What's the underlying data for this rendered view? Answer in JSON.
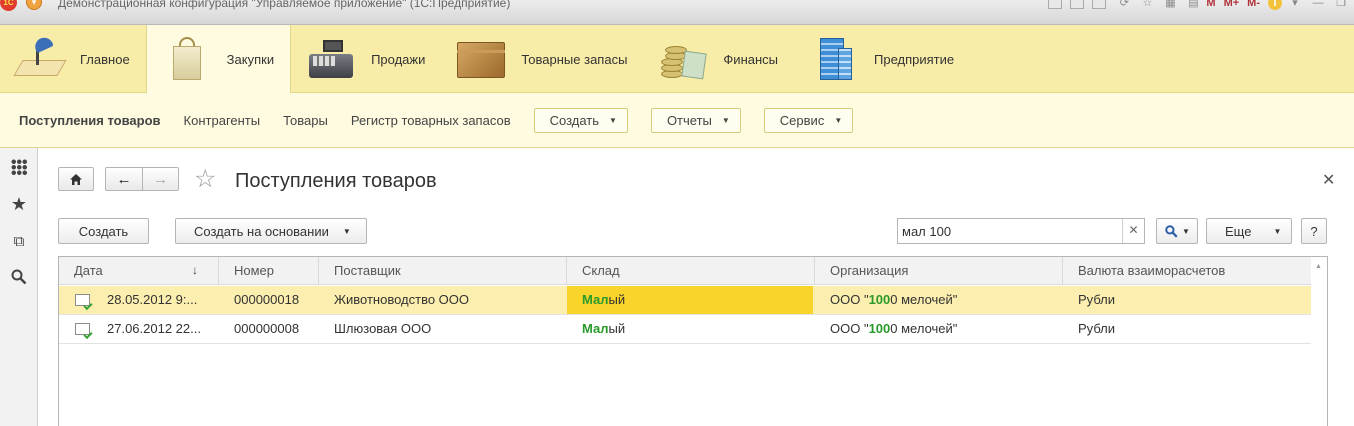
{
  "window": {
    "title": "Демонстрационная конфигурация \"Управляемое приложение\" (1С:Предприятие)",
    "logo_text": "1С",
    "toolbar_m_labels": [
      "M",
      "M+",
      "M-"
    ]
  },
  "sections": [
    {
      "label": "Главное",
      "icon": "desk-lamp-icon",
      "active": false
    },
    {
      "label": "Закупки",
      "icon": "shopping-bag-icon",
      "active": true
    },
    {
      "label": "Продажи",
      "icon": "cash-register-icon",
      "active": false
    },
    {
      "label": "Товарные запасы",
      "icon": "box-icon",
      "active": false
    },
    {
      "label": "Финансы",
      "icon": "coins-icon",
      "active": false
    },
    {
      "label": "Предприятие",
      "icon": "building-icon",
      "active": false
    }
  ],
  "commands": {
    "links": [
      "Поступления товаров",
      "Контрагенты",
      "Товары",
      "Регистр товарных запасов"
    ],
    "dropdowns": [
      "Создать",
      "Отчеты",
      "Сервис"
    ]
  },
  "form": {
    "title": "Поступления товаров",
    "create_label": "Создать",
    "create_based_label": "Создать на основании",
    "search_value": "мал 100",
    "more_label": "Еще",
    "help_label": "?"
  },
  "table": {
    "columns": [
      "Дата",
      "Номер",
      "Поставщик",
      "Склад",
      "Организация",
      "Валюта взаиморасчетов"
    ],
    "rows": [
      {
        "date": "28.05.2012 9:...",
        "number": "000000018",
        "supplier": "Животноводство ООО",
        "warehouse_hl": "Мал",
        "warehouse_rest": "ый",
        "org_pre": "ООО \"",
        "org_hl": "100",
        "org_post": "0 мелочей\"",
        "currency": "Рубли"
      },
      {
        "date": "27.06.2012 22...",
        "number": "000000008",
        "supplier": "Шлюзовая ООО",
        "warehouse_hl": "Мал",
        "warehouse_rest": "ый",
        "org_pre": "ООО \"",
        "org_hl": "100",
        "org_post": "0 мелочей\"",
        "currency": "Рубли"
      }
    ]
  },
  "colors": {
    "sections_bg": "#f8eda8",
    "commands_bg": "#fffbe0",
    "selected_row": "#fbeeae",
    "active_cell": "#f9d42a",
    "highlight_text": "#2a9a2a"
  }
}
